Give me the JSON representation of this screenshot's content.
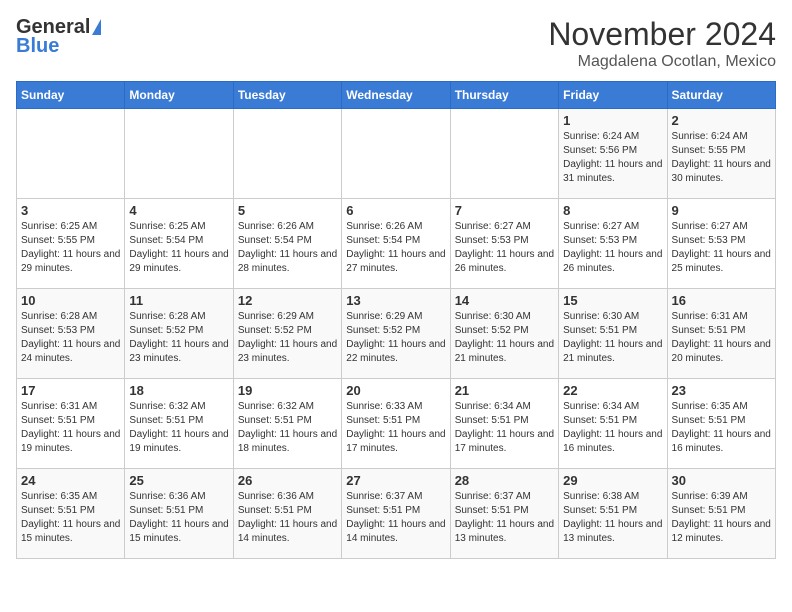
{
  "header": {
    "logo_general": "General",
    "logo_blue": "Blue",
    "month_title": "November 2024",
    "subtitle": "Magdalena Ocotlan, Mexico"
  },
  "calendar": {
    "days_of_week": [
      "Sunday",
      "Monday",
      "Tuesday",
      "Wednesday",
      "Thursday",
      "Friday",
      "Saturday"
    ],
    "weeks": [
      [
        {
          "day": "",
          "text": ""
        },
        {
          "day": "",
          "text": ""
        },
        {
          "day": "",
          "text": ""
        },
        {
          "day": "",
          "text": ""
        },
        {
          "day": "",
          "text": ""
        },
        {
          "day": "1",
          "text": "Sunrise: 6:24 AM\nSunset: 5:56 PM\nDaylight: 11 hours and 31 minutes."
        },
        {
          "day": "2",
          "text": "Sunrise: 6:24 AM\nSunset: 5:55 PM\nDaylight: 11 hours and 30 minutes."
        }
      ],
      [
        {
          "day": "3",
          "text": "Sunrise: 6:25 AM\nSunset: 5:55 PM\nDaylight: 11 hours and 29 minutes."
        },
        {
          "day": "4",
          "text": "Sunrise: 6:25 AM\nSunset: 5:54 PM\nDaylight: 11 hours and 29 minutes."
        },
        {
          "day": "5",
          "text": "Sunrise: 6:26 AM\nSunset: 5:54 PM\nDaylight: 11 hours and 28 minutes."
        },
        {
          "day": "6",
          "text": "Sunrise: 6:26 AM\nSunset: 5:54 PM\nDaylight: 11 hours and 27 minutes."
        },
        {
          "day": "7",
          "text": "Sunrise: 6:27 AM\nSunset: 5:53 PM\nDaylight: 11 hours and 26 minutes."
        },
        {
          "day": "8",
          "text": "Sunrise: 6:27 AM\nSunset: 5:53 PM\nDaylight: 11 hours and 26 minutes."
        },
        {
          "day": "9",
          "text": "Sunrise: 6:27 AM\nSunset: 5:53 PM\nDaylight: 11 hours and 25 minutes."
        }
      ],
      [
        {
          "day": "10",
          "text": "Sunrise: 6:28 AM\nSunset: 5:53 PM\nDaylight: 11 hours and 24 minutes."
        },
        {
          "day": "11",
          "text": "Sunrise: 6:28 AM\nSunset: 5:52 PM\nDaylight: 11 hours and 23 minutes."
        },
        {
          "day": "12",
          "text": "Sunrise: 6:29 AM\nSunset: 5:52 PM\nDaylight: 11 hours and 23 minutes."
        },
        {
          "day": "13",
          "text": "Sunrise: 6:29 AM\nSunset: 5:52 PM\nDaylight: 11 hours and 22 minutes."
        },
        {
          "day": "14",
          "text": "Sunrise: 6:30 AM\nSunset: 5:52 PM\nDaylight: 11 hours and 21 minutes."
        },
        {
          "day": "15",
          "text": "Sunrise: 6:30 AM\nSunset: 5:51 PM\nDaylight: 11 hours and 21 minutes."
        },
        {
          "day": "16",
          "text": "Sunrise: 6:31 AM\nSunset: 5:51 PM\nDaylight: 11 hours and 20 minutes."
        }
      ],
      [
        {
          "day": "17",
          "text": "Sunrise: 6:31 AM\nSunset: 5:51 PM\nDaylight: 11 hours and 19 minutes."
        },
        {
          "day": "18",
          "text": "Sunrise: 6:32 AM\nSunset: 5:51 PM\nDaylight: 11 hours and 19 minutes."
        },
        {
          "day": "19",
          "text": "Sunrise: 6:32 AM\nSunset: 5:51 PM\nDaylight: 11 hours and 18 minutes."
        },
        {
          "day": "20",
          "text": "Sunrise: 6:33 AM\nSunset: 5:51 PM\nDaylight: 11 hours and 17 minutes."
        },
        {
          "day": "21",
          "text": "Sunrise: 6:34 AM\nSunset: 5:51 PM\nDaylight: 11 hours and 17 minutes."
        },
        {
          "day": "22",
          "text": "Sunrise: 6:34 AM\nSunset: 5:51 PM\nDaylight: 11 hours and 16 minutes."
        },
        {
          "day": "23",
          "text": "Sunrise: 6:35 AM\nSunset: 5:51 PM\nDaylight: 11 hours and 16 minutes."
        }
      ],
      [
        {
          "day": "24",
          "text": "Sunrise: 6:35 AM\nSunset: 5:51 PM\nDaylight: 11 hours and 15 minutes."
        },
        {
          "day": "25",
          "text": "Sunrise: 6:36 AM\nSunset: 5:51 PM\nDaylight: 11 hours and 15 minutes."
        },
        {
          "day": "26",
          "text": "Sunrise: 6:36 AM\nSunset: 5:51 PM\nDaylight: 11 hours and 14 minutes."
        },
        {
          "day": "27",
          "text": "Sunrise: 6:37 AM\nSunset: 5:51 PM\nDaylight: 11 hours and 14 minutes."
        },
        {
          "day": "28",
          "text": "Sunrise: 6:37 AM\nSunset: 5:51 PM\nDaylight: 11 hours and 13 minutes."
        },
        {
          "day": "29",
          "text": "Sunrise: 6:38 AM\nSunset: 5:51 PM\nDaylight: 11 hours and 13 minutes."
        },
        {
          "day": "30",
          "text": "Sunrise: 6:39 AM\nSunset: 5:51 PM\nDaylight: 11 hours and 12 minutes."
        }
      ]
    ]
  }
}
